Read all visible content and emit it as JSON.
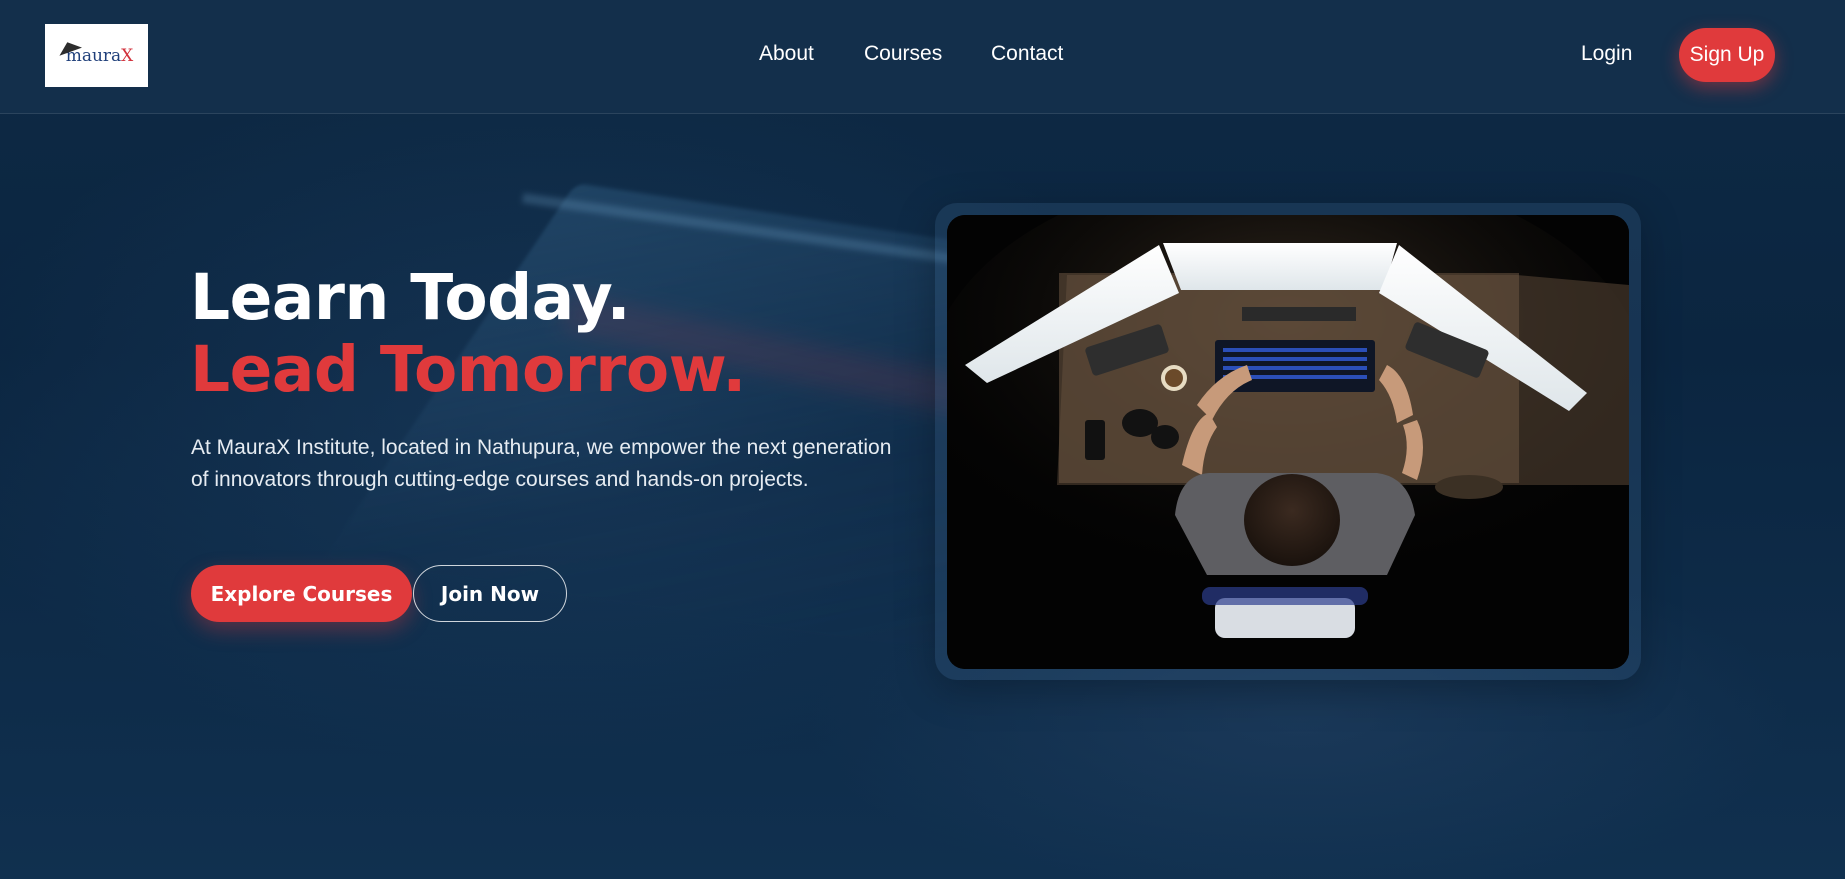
{
  "brand": {
    "logo_text_main": "maura",
    "logo_text_accent": "X",
    "logo_icon": "paper-plane-icon"
  },
  "nav": {
    "about": "About",
    "courses": "Courses",
    "contact": "Contact"
  },
  "auth": {
    "login": "Login",
    "signup": "Sign Up"
  },
  "hero": {
    "title_line1": "Learn Today.",
    "title_line2": "Lead Tomorrow.",
    "description": "At MauraX Institute, located in Nathupura, we empower the next generation of innovators through cutting-edge courses and hands-on projects.",
    "primary_cta": "Explore Courses",
    "secondary_cta": "Join Now",
    "image_subject": "person-at-desk-with-three-monitors"
  },
  "colors": {
    "accent": "#e03a3c",
    "background": "#0d2a48",
    "text": "#ffffff"
  }
}
